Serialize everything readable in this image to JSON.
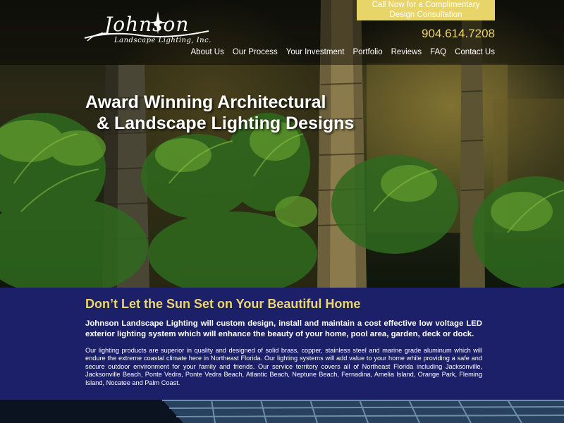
{
  "header": {
    "logo": {
      "name": "Johnson",
      "subtitle": "Landscape Lighting, Inc."
    },
    "cta": {
      "line1": "Call Now for a Complimentary",
      "line2": "Design Consultation"
    },
    "phone": "904.614.7208",
    "nav": [
      {
        "label": "About Us"
      },
      {
        "label": "Our Process"
      },
      {
        "label": "Your Investment"
      },
      {
        "label": "Portfolio"
      },
      {
        "label": "Reviews"
      },
      {
        "label": "FAQ"
      },
      {
        "label": "Contact Us"
      }
    ]
  },
  "hero": {
    "title_line1": "Award Winning Architectural",
    "title_line2": "& Landscape Lighting Designs"
  },
  "info": {
    "heading": "Don’t Let the Sun Set on Your Beautiful Home",
    "lead": "Johnson Landscape Lighting will custom design, install and maintain a cost effective low voltage LED exterior lighting system which will enhance the beauty of your home, pool area, garden, deck or dock.",
    "body": "Our lighting products are superior in quality and designed of solid brass, copper, stainless steel and marine grade aluminum which will endure the extreme coastal climate here in Northeast Florida.  Our lighting systems will add value to your home while providing a safe and secure outdoor environment for your family and friends.  Our service territory covers all of Northeast Florida including Jacksonville, Jacksonville Beach, Ponte Vedra, Ponte Vedra Beach, Atlantic Beach, Neptune Beach, Fernadina, Amelia Island, Orange Park, Fleming Island, Nocatee and Palm Coast."
  },
  "colors": {
    "accent_yellow": "#ecd56a",
    "cta_background": "#e8d56a",
    "band_navy": "#1c2068",
    "text_white": "#ffffff"
  }
}
